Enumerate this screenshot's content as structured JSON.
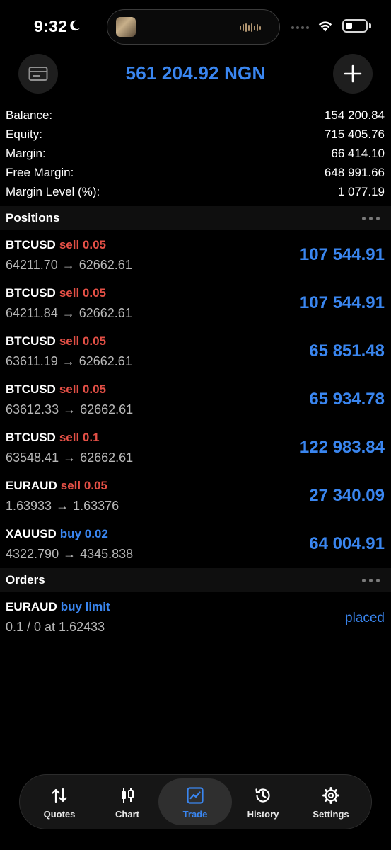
{
  "status_bar": {
    "time": "9:32"
  },
  "header": {
    "equity_title": "561 204.92 NGN"
  },
  "summary": [
    {
      "label": "Balance:",
      "value": "154 200.84"
    },
    {
      "label": "Equity:",
      "value": "715 405.76"
    },
    {
      "label": "Margin:",
      "value": "66 414.10"
    },
    {
      "label": "Free Margin:",
      "value": "648 991.66"
    },
    {
      "label": "Margin Level (%):",
      "value": "1 077.19"
    }
  ],
  "positions": {
    "title": "Positions",
    "rows": [
      {
        "symbol": "BTCUSD",
        "side": "sell 0.05",
        "open": "64211.70",
        "current": "62662.61",
        "profit": "107 544.91"
      },
      {
        "symbol": "BTCUSD",
        "side": "sell 0.05",
        "open": "64211.84",
        "current": "62662.61",
        "profit": "107 544.91"
      },
      {
        "symbol": "BTCUSD",
        "side": "sell 0.05",
        "open": "63611.19",
        "current": "62662.61",
        "profit": "65 851.48"
      },
      {
        "symbol": "BTCUSD",
        "side": "sell 0.05",
        "open": "63612.33",
        "current": "62662.61",
        "profit": "65 934.78"
      },
      {
        "symbol": "BTCUSD",
        "side": "sell 0.1",
        "open": "63548.41",
        "current": "62662.61",
        "profit": "122 983.84"
      },
      {
        "symbol": "EURAUD",
        "side": "sell 0.05",
        "open": "1.63933",
        "current": "1.63376",
        "profit": "27 340.09"
      },
      {
        "symbol": "XAUUSD",
        "side": "buy 0.02",
        "open": "4322.790",
        "current": "4345.838",
        "profit": "64 004.91"
      }
    ]
  },
  "orders": {
    "title": "Orders",
    "rows": [
      {
        "symbol": "EURAUD",
        "side": "buy limit",
        "detail": "0.1 / 0 at 1.62433",
        "status": "placed"
      }
    ]
  },
  "arrow_glyph": "→",
  "tab_bar": {
    "tabs": [
      {
        "label": "Quotes",
        "icon": "quotes-arrows-icon"
      },
      {
        "label": "Chart",
        "icon": "candlestick-icon"
      },
      {
        "label": "Trade",
        "icon": "trade-chart-icon",
        "active": true
      },
      {
        "label": "History",
        "icon": "history-clock-icon"
      },
      {
        "label": "Settings",
        "icon": "gear-icon"
      }
    ]
  },
  "colors": {
    "accent": "#3a86f0",
    "sell": "#e45046",
    "background": "#000000"
  }
}
